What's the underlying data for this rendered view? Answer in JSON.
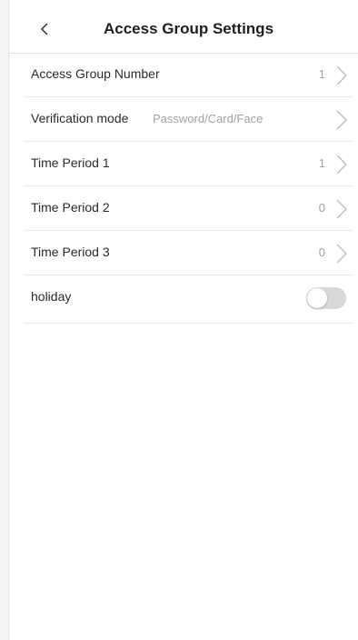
{
  "header": {
    "title": "Access Group Settings",
    "back_icon": "chevron-left-icon"
  },
  "rows": [
    {
      "label": "Access Group Number",
      "value": "1",
      "icon": "chevron-right-icon"
    },
    {
      "label": "Verification mode",
      "value": "Password/Card/Face",
      "icon": "chevron-right-icon"
    },
    {
      "label": "Time Period 1",
      "value": "1",
      "icon": "chevron-right-icon"
    },
    {
      "label": "Time Period 2",
      "value": "0",
      "icon": "chevron-right-icon"
    },
    {
      "label": "Time Period 3",
      "value": "0",
      "icon": "chevron-right-icon"
    }
  ],
  "holiday": {
    "label": "holiday",
    "enabled": false
  },
  "colors": {
    "toggle_off": "#d9d9d9",
    "divider": "#e7e7e7",
    "value_text": "#a2a2a2"
  }
}
